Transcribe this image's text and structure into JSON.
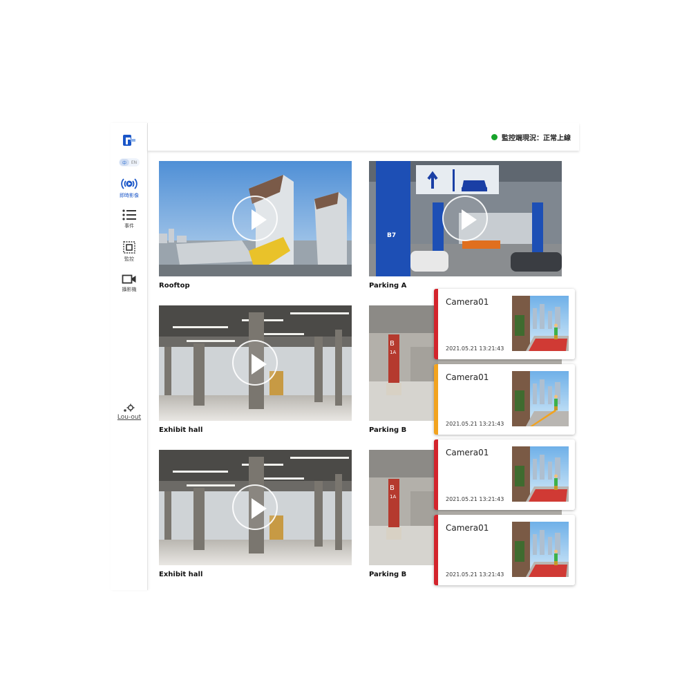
{
  "sidebar": {
    "lang": {
      "active": "中",
      "inactive": "EN"
    },
    "items": [
      {
        "label": "即時影像",
        "icon": "live-stream-icon",
        "active": true
      },
      {
        "label": "事件",
        "icon": "list-icon",
        "active": false
      },
      {
        "label": "監控",
        "icon": "monitor-frame-icon",
        "active": false
      },
      {
        "label": "攝影機",
        "icon": "camera-icon",
        "active": false
      }
    ],
    "logout_label": "Lou-out"
  },
  "header": {
    "status_text": "監控端現況：正常上線",
    "status_color": "#17a32b"
  },
  "tiles": [
    {
      "label": "Rooftop",
      "scene": "rooftop"
    },
    {
      "label": "Parking A",
      "scene": "parking-a"
    },
    {
      "label": "Exhibit hall",
      "scene": "hall"
    },
    {
      "label": "Parking B",
      "scene": "parking-b"
    },
    {
      "label": "Exhibit hall",
      "scene": "hall"
    },
    {
      "label": "Parking B",
      "scene": "parking-b"
    }
  ],
  "alerts": [
    {
      "camera": "Camera01",
      "time": "2021.05.21 13:21:43",
      "level_color": "#d3242c"
    },
    {
      "camera": "Camera01",
      "time": "2021.05.21 13:21:43",
      "level_color": "#f2a31f"
    },
    {
      "camera": "Camera01",
      "time": "2021.05.21 13:21:43",
      "level_color": "#d3242c"
    },
    {
      "camera": "Camera01",
      "time": "2021.05.21 13:21:43",
      "level_color": "#d3242c"
    }
  ]
}
